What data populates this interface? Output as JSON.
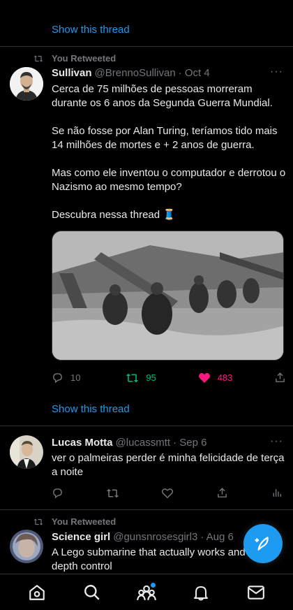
{
  "top_partial": {
    "show_thread": "Show this thread"
  },
  "tweets": [
    {
      "retweet_label": "You Retweeted",
      "name": "Sullivan",
      "handle": "@BrennoSullivan",
      "time": "· Oct 4",
      "paragraphs": [
        "Cerca de 75 milhões de pessoas morreram durante os 6 anos da Segunda Guerra Mundial.",
        "Se não fosse por Alan Turing, teríamos tido mais 14 milhões de mortes e + 2 anos de guerra.",
        "Mas como ele inventou o computador e derrotou o Nazismo ao mesmo tempo?",
        "Descubra nessa thread 🧵"
      ],
      "reply_count": "10",
      "retweet_count": "95",
      "like_count": "483",
      "show_thread": "Show this thread"
    },
    {
      "name": "Lucas Motta",
      "handle": "@lucassmtt",
      "time": "· Sep 6",
      "text": "ver o palmeiras perder é minha felicidade de terça a noite"
    },
    {
      "retweet_label": "You Retweeted",
      "name": "Science girl",
      "handle": "@gunsnrosesgirl3",
      "time": "· Aug 6",
      "text": "A Lego submarine that actually works and has depth control"
    }
  ],
  "colors": {
    "accent": "#1d9bf0",
    "retweet_green": "#00ba7c",
    "like_pink": "#f91880",
    "muted": "#71767b"
  },
  "icons": [
    "retweet-icon",
    "reply-icon",
    "like-icon",
    "share-icon",
    "analytics-icon",
    "compose-icon",
    "home-icon",
    "search-icon",
    "communities-icon",
    "notifications-icon",
    "messages-icon"
  ]
}
